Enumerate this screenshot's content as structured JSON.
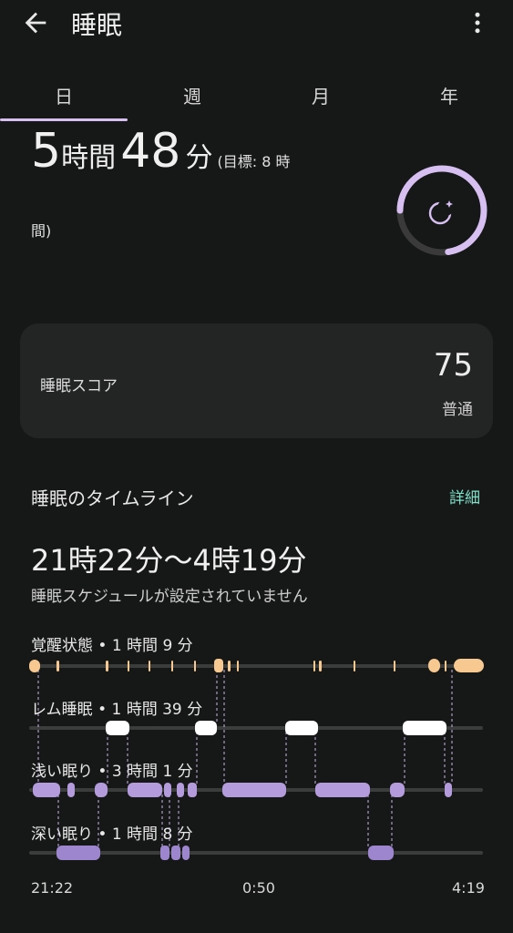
{
  "app_bar": {
    "title": "睡眠",
    "back_icon": "arrow-left-icon",
    "menu_icon": "more-vert-icon"
  },
  "tabs": [
    {
      "label": "日",
      "selected": true
    },
    {
      "label": "週",
      "selected": false
    },
    {
      "label": "月",
      "selected": false
    },
    {
      "label": "年",
      "selected": false
    }
  ],
  "duration": {
    "hours": "5",
    "hours_unit": "時間",
    "minutes": "48",
    "minutes_unit": "分",
    "goal_line1": "(目標: 8 時",
    "goal_line2": "間)",
    "goal_progress": 0.725,
    "ring_icon": "moon-stars-icon",
    "ring_color": "#d8bff2"
  },
  "score": {
    "label": "睡眠スコア",
    "value": "75",
    "description": "普通"
  },
  "timeline": {
    "title": "睡眠のタイムライン",
    "details_link": "詳細",
    "range": "21時22分〜4時19分",
    "schedule_note": "睡眠スケジュールが設定されていません",
    "stages": [
      {
        "key": "awake",
        "label": "覚醒状態 • 1 時間 9 分",
        "color": "#f7c990"
      },
      {
        "key": "rem",
        "label": "レム睡眠 • 1 時間 39 分",
        "color": "#ffffff"
      },
      {
        "key": "light",
        "label": "浅い眠り • 3 時間 1 分",
        "color": "#b49bdc"
      },
      {
        "key": "deep",
        "label": "深い眠り • 1 時間 8 分",
        "color": "#9e86cf"
      }
    ],
    "axis": [
      "21:22",
      "0:50",
      "4:19"
    ]
  }
}
